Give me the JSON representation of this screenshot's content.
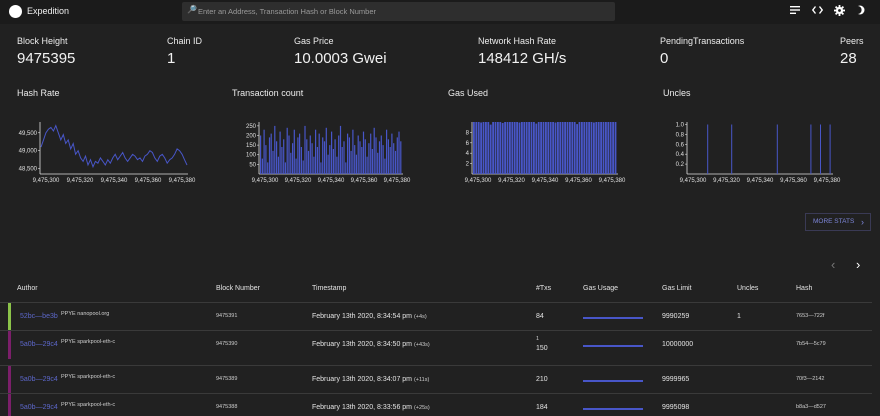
{
  "app": {
    "title": "Expedition"
  },
  "search": {
    "placeholder": "Enter an Address, Transaction Hash or Block Number"
  },
  "icons": {
    "search": "magnifier-icon",
    "notes": "notes-icon",
    "code": "code-icon",
    "settings": "gear-icon",
    "theme": "moon-icon"
  },
  "stats": [
    {
      "label": "Block Height",
      "value": "9475395"
    },
    {
      "label": "Chain ID",
      "value": "1"
    },
    {
      "label": "Gas Price",
      "value": "10.0003 Gwei"
    },
    {
      "label": "Network Hash Rate",
      "value": "148412 GH/s"
    },
    {
      "label": "PendingTransactions",
      "value": "0"
    },
    {
      "label": "Peers",
      "value": "28"
    }
  ],
  "chart_titles": {
    "hash_rate": "Hash Rate",
    "tx_count": "Transaction count",
    "gas_used": "Gas Used",
    "uncles": "Uncles"
  },
  "chart_data": [
    {
      "type": "line",
      "title": "Hash Rate",
      "x_ticks": [
        "9,475,300",
        "9,475,320",
        "9,475,340",
        "9,475,360",
        "9,475,380"
      ],
      "y_ticks": [
        "48,500",
        "49,000",
        "49,500"
      ],
      "ylim": [
        48350,
        49800
      ],
      "values": [
        49100,
        49300,
        49500,
        49600,
        49650,
        49550,
        49700,
        49500,
        49300,
        49450,
        49200,
        49300,
        49050,
        49200,
        48900,
        49000,
        48800,
        48700,
        48850,
        48600,
        48750,
        48550,
        48700,
        48650,
        48800,
        48700,
        48600,
        48750,
        48650,
        48800,
        48900,
        48750,
        48850,
        48950,
        48800,
        48700,
        48800,
        48900,
        48850,
        48750,
        48800,
        48700,
        48850,
        48900,
        49000,
        48950,
        48800,
        48700,
        48850,
        48900,
        48800,
        48650,
        48750,
        48800,
        48900,
        49050,
        49000,
        48900,
        48750,
        48600
      ]
    },
    {
      "type": "bar",
      "title": "Transaction count",
      "x_ticks": [
        "9,475,300",
        "9,475,320",
        "9,475,340",
        "9,475,360",
        "9,475,380"
      ],
      "y_ticks": [
        "50",
        "100",
        "150",
        "200",
        "250"
      ],
      "ylim": [
        0,
        270
      ],
      "values": [
        200,
        80,
        230,
        150,
        60,
        190,
        210,
        120,
        250,
        170,
        90,
        220,
        140,
        180,
        60,
        240,
        200,
        110,
        160,
        230,
        80,
        190,
        210,
        140,
        70,
        250,
        180,
        120,
        200,
        160,
        90,
        230,
        140,
        210,
        60,
        190,
        170,
        240,
        100,
        150,
        220,
        130,
        180,
        90,
        200,
        250,
        140,
        170,
        60,
        210,
        190,
        120,
        230,
        150,
        100,
        200,
        170,
        140,
        220,
        180,
        90,
        160,
        210,
        130,
        240,
        190,
        110,
        170,
        200,
        150,
        80,
        230,
        180,
        140,
        210,
        160,
        120,
        190,
        220,
        170
      ]
    },
    {
      "type": "bar",
      "title": "Gas Used",
      "x_ticks": [
        "9,475,300",
        "9,475,320",
        "9,475,340",
        "9,475,360",
        "9,475,380"
      ],
      "y_ticks": [
        "2",
        "4",
        "6",
        "8"
      ],
      "ylim": [
        0,
        10
      ],
      "values": [
        10,
        10,
        10,
        9.9,
        10,
        10,
        10,
        9.5,
        10,
        10,
        10,
        10,
        9.8,
        10,
        10,
        10,
        10,
        10,
        10,
        9.9,
        10,
        10,
        10,
        10,
        10,
        10,
        9.7,
        10,
        10,
        10,
        10,
        10,
        10,
        10,
        9.9,
        10,
        10,
        10,
        10,
        10,
        10,
        10,
        10,
        9.6,
        10,
        10,
        10,
        10,
        10,
        10,
        9.9,
        10,
        10,
        10,
        10,
        10,
        10,
        10,
        10,
        10
      ]
    },
    {
      "type": "bar",
      "title": "Uncles",
      "x_ticks": [
        "9,475,300",
        "9,475,320",
        "9,475,340",
        "9,475,360",
        "9,475,380"
      ],
      "y_ticks": [
        "0.2",
        "0.4",
        "0.6",
        "0.8",
        "1.0"
      ],
      "ylim": [
        0,
        1.05
      ],
      "values": [
        0,
        0,
        0,
        0,
        0,
        0,
        0,
        0,
        1,
        0,
        0,
        0,
        0,
        0,
        0,
        0,
        0,
        0,
        1,
        0,
        0,
        0,
        0,
        0,
        0,
        0,
        0,
        0,
        0,
        0,
        0,
        0,
        0,
        0,
        0,
        0,
        0,
        1,
        0,
        0,
        0,
        0,
        0,
        0,
        0,
        0,
        0,
        0,
        0,
        0,
        0,
        1,
        0,
        0,
        0,
        1,
        0,
        0,
        0,
        1
      ]
    }
  ],
  "more_stats": {
    "label": "MORE STATS",
    "icon": "chevron-right-icon"
  },
  "pager": {
    "prev_icon": "chevron-left-icon",
    "next_icon": "chevron-right-icon"
  },
  "table": {
    "headers": [
      "Author",
      "Block Number",
      "Timestamp",
      "#Txs",
      "Gas Usage",
      "Gas Limit",
      "Uncles",
      "Hash"
    ],
    "rows": [
      {
        "author": "52bc—be3b",
        "tag": "PPYE nanopool.org",
        "block": "9475391",
        "timestamp": "February 13th 2020, 8:34:54 pm",
        "ago": "(+4s)",
        "txs_top": "",
        "txs": "84",
        "gas_usage": 0.9,
        "gas_limit": "9990259",
        "uncles": "1",
        "hash": "7653—722f",
        "color": "#8bc34a"
      },
      {
        "author": "5a0b—29c4",
        "tag": "PPYE sparkpool-eth-c",
        "block": "9475390",
        "timestamp": "February 13th 2020, 8:34:50 pm",
        "ago": "(+43s)",
        "txs_top": "1",
        "txs": "150",
        "gas_usage": 0.9,
        "gas_limit": "10000000",
        "uncles": "",
        "hash": "7b54—5c79",
        "color": "#7b1f6a"
      },
      {
        "author": "5a0b—29c4",
        "tag": "PPYE sparkpool-eth-c",
        "block": "9475389",
        "timestamp": "February 13th 2020, 8:34:07 pm",
        "ago": "(+11s)",
        "txs_top": "",
        "txs": "210",
        "gas_usage": 0.9,
        "gas_limit": "9999965",
        "uncles": "",
        "hash": "70f3—2142",
        "color": "#7b1f6a"
      },
      {
        "author": "5a0b—29c4",
        "tag": "PPYE sparkpool-eth-c",
        "block": "9475388",
        "timestamp": "February 13th 2020, 8:33:56 pm",
        "ago": "(+25s)",
        "txs_top": "",
        "txs": "184",
        "gas_usage": 0.9,
        "gas_limit": "9995098",
        "uncles": "",
        "hash": "b8a3—d527",
        "color": "#7b1f6a"
      }
    ]
  }
}
